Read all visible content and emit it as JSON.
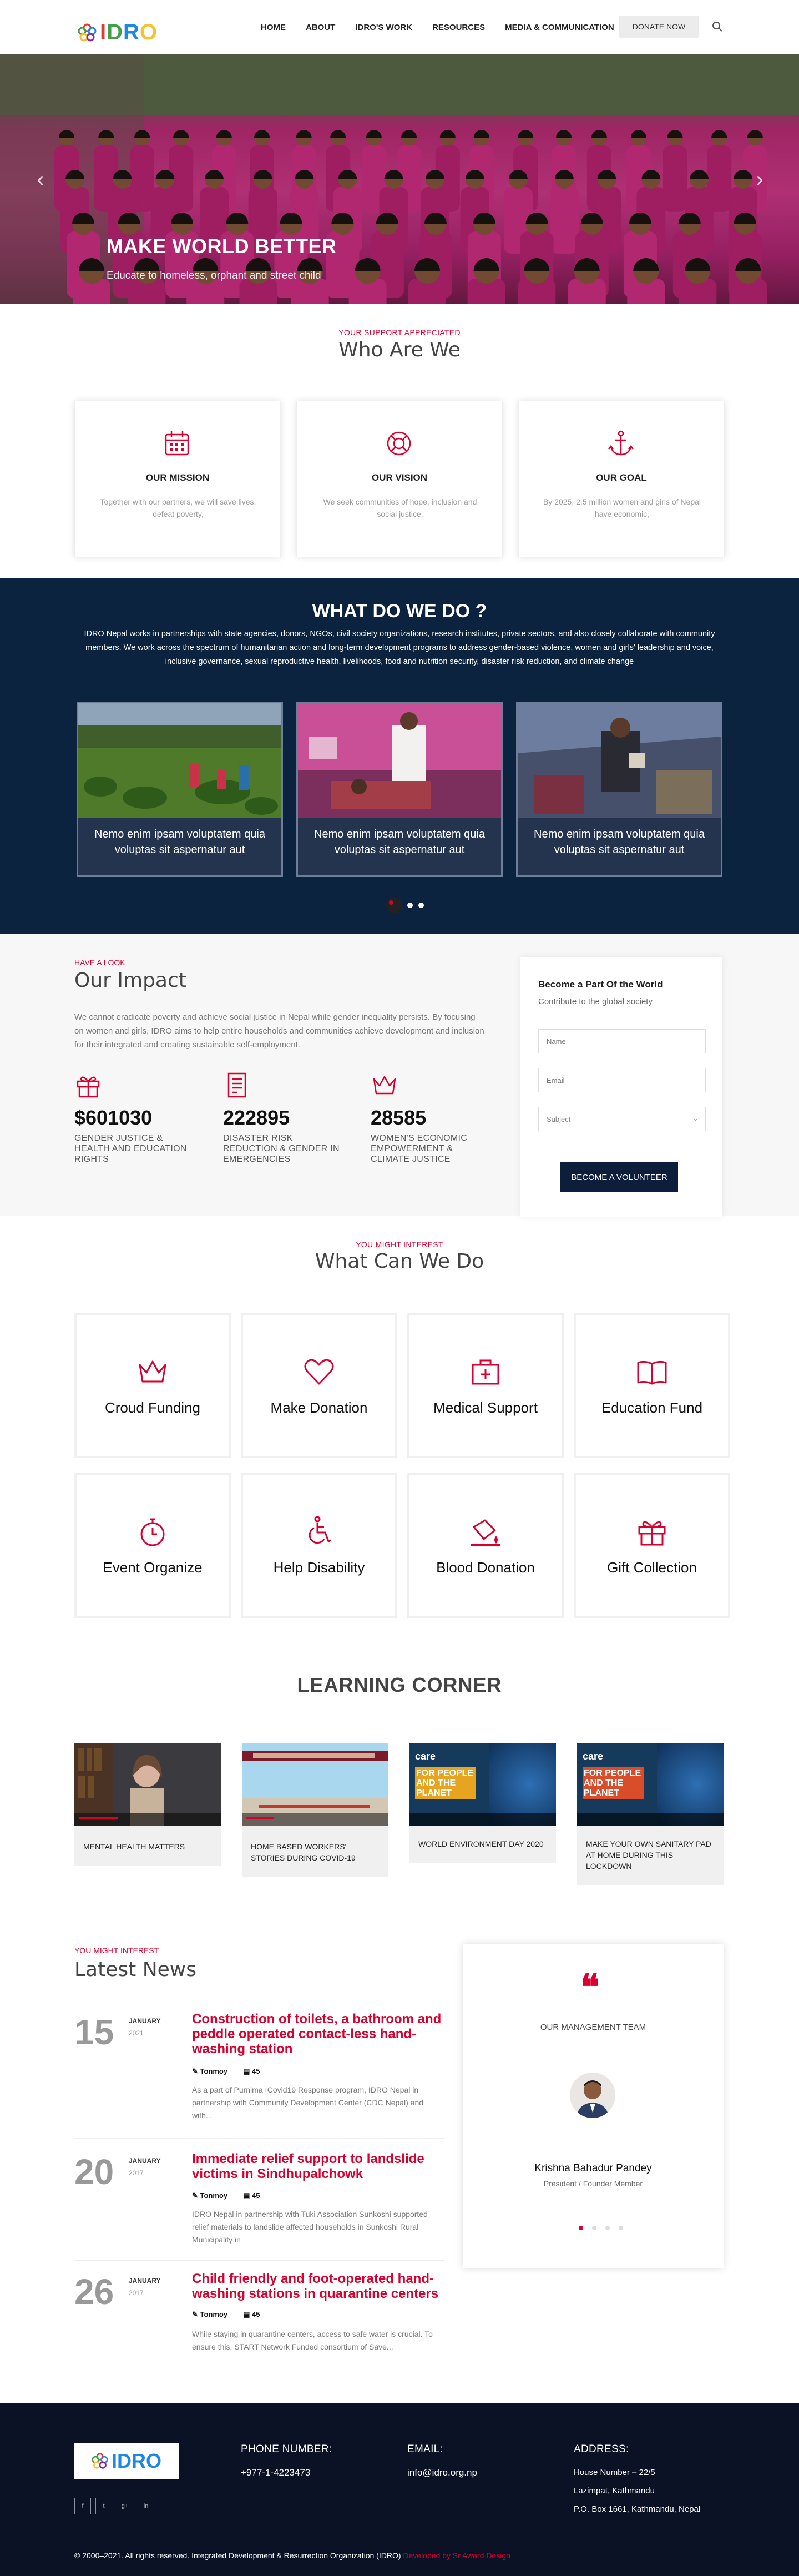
{
  "header": {
    "logo_text": "IDRO",
    "nav": [
      "HOME",
      "ABOUT",
      "IDRO'S WORK",
      "RESOURCES",
      "MEDIA & COMMUNICATION"
    ],
    "donate_label": "DONATE NOW"
  },
  "hero": {
    "title": "MAKE WORLD BETTER",
    "subtitle": "Educate to homeless, orphant and street child"
  },
  "who": {
    "kicker": "YOUR SUPPORT APPRECIATED",
    "title": "Who Are We",
    "cards": [
      {
        "icon": "calendar-icon",
        "title": "OUR MISSION",
        "text": "Together with our partners, we will save lives, defeat poverty,"
      },
      {
        "icon": "lifebuoy-icon",
        "title": "OUR VISION",
        "text": "We seek communities of hope, inclusion and social justice,"
      },
      {
        "icon": "anchor-icon",
        "title": "OUR GOAL",
        "text": "By 2025, 2.5 million women and girls of Nepal have economic,"
      }
    ]
  },
  "what": {
    "title": "WHAT DO WE DO ?",
    "description": "IDRO Nepal works in partnerships with state agencies, donors, NGOs, civil society organizations, research institutes, private sectors, and also closely collaborate with community members. We work across the spectrum of humanitarian action and long-term development programs to address gender-based violence, women and girls' leadership and voice, inclusive governance, sexual reproductive health, livelihoods, food and nutrition security, disaster risk reduction, and climate change",
    "cards": [
      {
        "caption": "Nemo enim ipsam voluptatem quia voluptas sit aspernatur aut"
      },
      {
        "caption": "Nemo enim ipsam voluptatem quia voluptas sit aspernatur aut"
      },
      {
        "caption": "Nemo enim ipsam voluptatem quia voluptas sit aspernatur aut"
      }
    ]
  },
  "impact": {
    "kicker": "HAVE A LOOK",
    "title": "Our Impact",
    "text": "We cannot eradicate poverty and achieve social justice in Nepal while gender inequality persists. By focusing on women and girls, IDRO aims to help entire households and communities achieve development and inclusion for their integrated and creating sustainable self-employment.",
    "stats": [
      {
        "icon": "gift-icon",
        "value": "$601030",
        "label": "GENDER JUSTICE & HEALTH AND EDUCATION RIGHTS"
      },
      {
        "icon": "document-icon",
        "value": "222895",
        "label": "DISASTER RISK REDUCTION & GENDER IN EMERGENCIES"
      },
      {
        "icon": "crown-icon",
        "value": "28585",
        "label": "WOMEN'S ECONOMIC EMPOWERMENT & CLIMATE JUSTICE"
      }
    ],
    "form": {
      "title": "Become a Part Of the World",
      "subtitle": "Contribute to the global society",
      "name_placeholder": "Name",
      "email_placeholder": "Email",
      "subject_placeholder": "Subject",
      "button": "BECOME A VOLUNTEER"
    }
  },
  "services": {
    "kicker": "YOU MIGHT INTEREST",
    "title": "What Can We Do",
    "items": [
      {
        "icon": "crown-icon",
        "label": "Croud Funding"
      },
      {
        "icon": "heart-icon",
        "label": "Make Donation"
      },
      {
        "icon": "medical-kit-icon",
        "label": "Medical Support"
      },
      {
        "icon": "book-icon",
        "label": "Education Fund"
      },
      {
        "icon": "stopwatch-icon",
        "label": "Event Organize"
      },
      {
        "icon": "wheelchair-icon",
        "label": "Help Disability"
      },
      {
        "icon": "blood-drop-icon",
        "label": "Blood Donation"
      },
      {
        "icon": "gift-icon",
        "label": "Gift Collection"
      }
    ]
  },
  "learning": {
    "title": "LEARNING CORNER",
    "videos": [
      {
        "caption": "MENTAL HEALTH MATTERS"
      },
      {
        "caption": "HOME BASED WORKERS' STORIES DURING COVID-19"
      },
      {
        "caption": "WORLD ENVIRONMENT DAY 2020"
      },
      {
        "caption": "MAKE YOUR OWN SANITARY PAD AT HOME DURING THIS LOCKDOWN"
      }
    ],
    "poster_text": "FOR PEOPLE AND THE PLANET",
    "poster_brand": "care"
  },
  "news": {
    "kicker": "YOU MIGHT INTEREST",
    "title": "Latest News",
    "items": [
      {
        "day": "15",
        "month": "JANUARY",
        "year": "2021",
        "title": "Construction of toilets, a bathroom and peddle operated contact-less hand-washing station",
        "author": "Tonmoy",
        "count": "45",
        "excerpt": "As a part of Purnima+Covid19 Response program, IDRO Nepal in partnership with Community Development Center (CDC Nepal) and with..."
      },
      {
        "day": "20",
        "month": "JANUARY",
        "year": "2017",
        "title": "Immediate relief support to landslide victims in Sindhupalchowk",
        "author": "Tonmoy",
        "count": "45",
        "excerpt": "IDRO Nepal in partnership with Tuki Association Sunkoshi supported relief materials to landslide affected households in Sunkoshi Rural Municipality in"
      },
      {
        "day": "26",
        "month": "JANUARY",
        "year": "2017",
        "title": "Child friendly and foot-operated hand-washing stations in quarantine centers",
        "author": "Tonmoy",
        "count": "45",
        "excerpt": "While staying in quarantine centers, access to safe water is crucial. To ensure this, START Network Funded consortium of Save..."
      }
    ]
  },
  "team": {
    "label": "OUR MANAGEMENT TEAM",
    "name": "Krishna Bahadur Pandey",
    "role": "President / Founder Member"
  },
  "footer": {
    "logo_text": "IDRO",
    "social": [
      "f",
      "t",
      "g+",
      "in"
    ],
    "phone_label": "PHONE NUMBER:",
    "phone": "+977-1-4223473",
    "email_label": "EMAIL:",
    "email": "info@idro.org.np",
    "address_label": "ADDRESS:",
    "address": [
      "House Number – 22/5",
      "Lazimpat, Kathmandu",
      "P.O. Box 1661, Kathmandu, Nepal"
    ],
    "copyright": "© 2000–2021. All rights reserved. Integrated Development & Resurrection Organization (IDRO)",
    "developer": "Developed by Sr Award Design"
  },
  "colors": {
    "accent": "#d9002d",
    "navy": "#0c2340",
    "footer": "#0c1226"
  }
}
